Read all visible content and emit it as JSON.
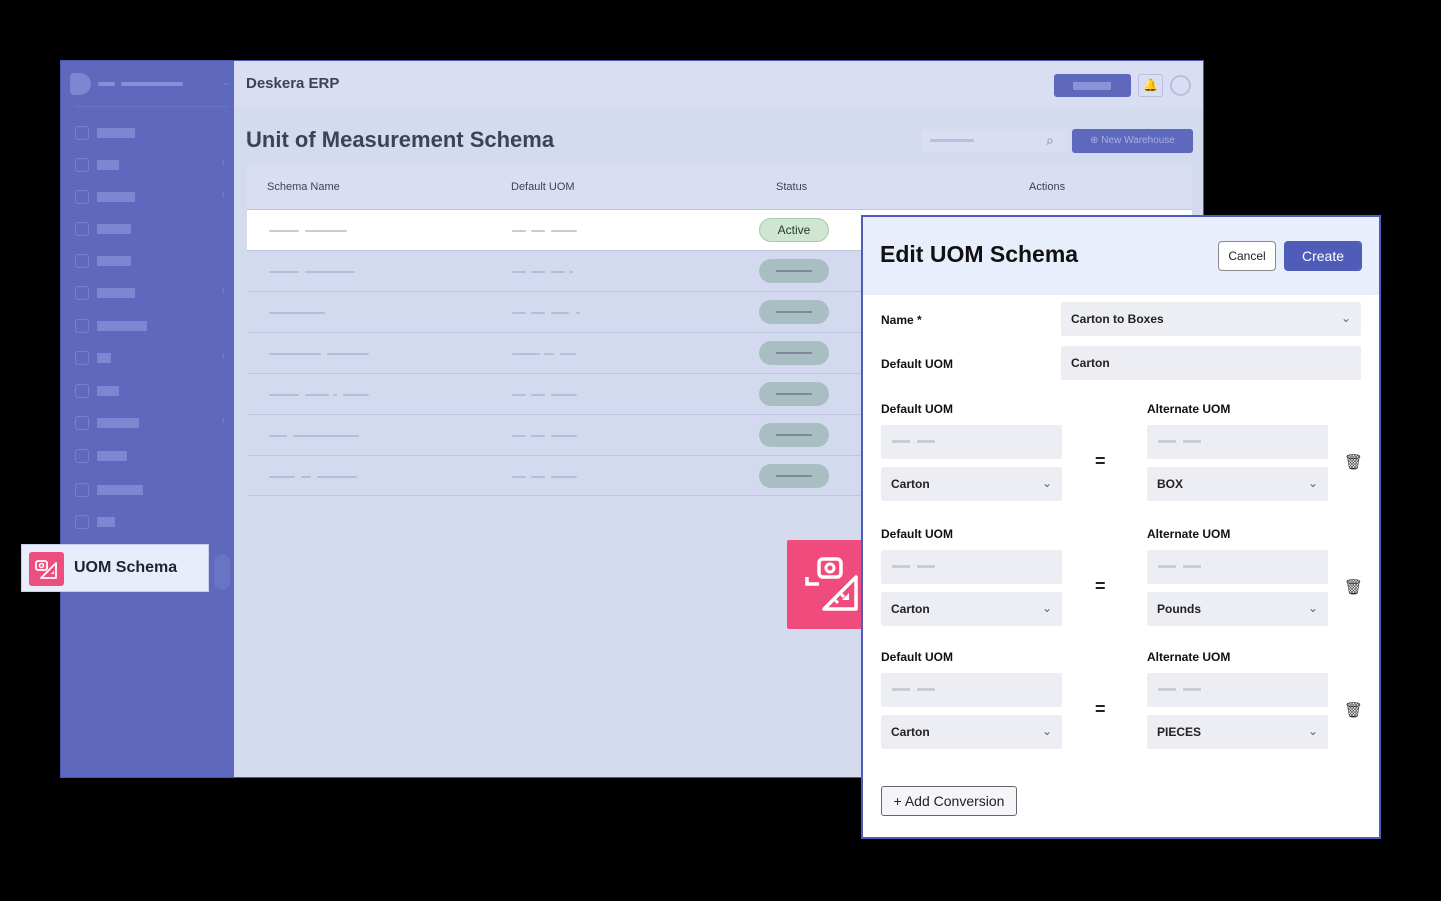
{
  "app": {
    "brand": "Deskera ERP",
    "page_title": "Unit of Measurement Schema",
    "new_warehouse_label": "⊕ New Warehouse"
  },
  "table": {
    "headers": [
      "Schema Name",
      "Default UOM",
      "Status",
      "Actions"
    ],
    "first_row_status": "Active"
  },
  "sidebar": {
    "active_item_label": "UOM Schema"
  },
  "modal": {
    "title": "Edit UOM Schema",
    "cancel_label": "Cancel",
    "create_label": "Create",
    "name_label": "Name *",
    "name_value": "Carton to Boxes",
    "default_uom_label": "Default UOM",
    "default_uom_value": "Carton",
    "conversions": [
      {
        "left_label": "Default UOM",
        "right_label": "Alternate UOM",
        "left_unit": "Carton",
        "right_unit": "BOX"
      },
      {
        "left_label": "Default UOM",
        "right_label": "Alternate UOM",
        "left_unit": "Carton",
        "right_unit": "Pounds"
      },
      {
        "left_label": "Default UOM",
        "right_label": "Alternate UOM",
        "left_unit": "Carton",
        "right_unit": "PIECES"
      }
    ],
    "equals": "=",
    "add_conversion_label": "+ Add Conversion"
  },
  "colors": {
    "sidebar": "#5e68bd",
    "accent": "#4f5db8",
    "uom_icon": "#ec4e7f",
    "active_status": "#cfe7d2"
  }
}
